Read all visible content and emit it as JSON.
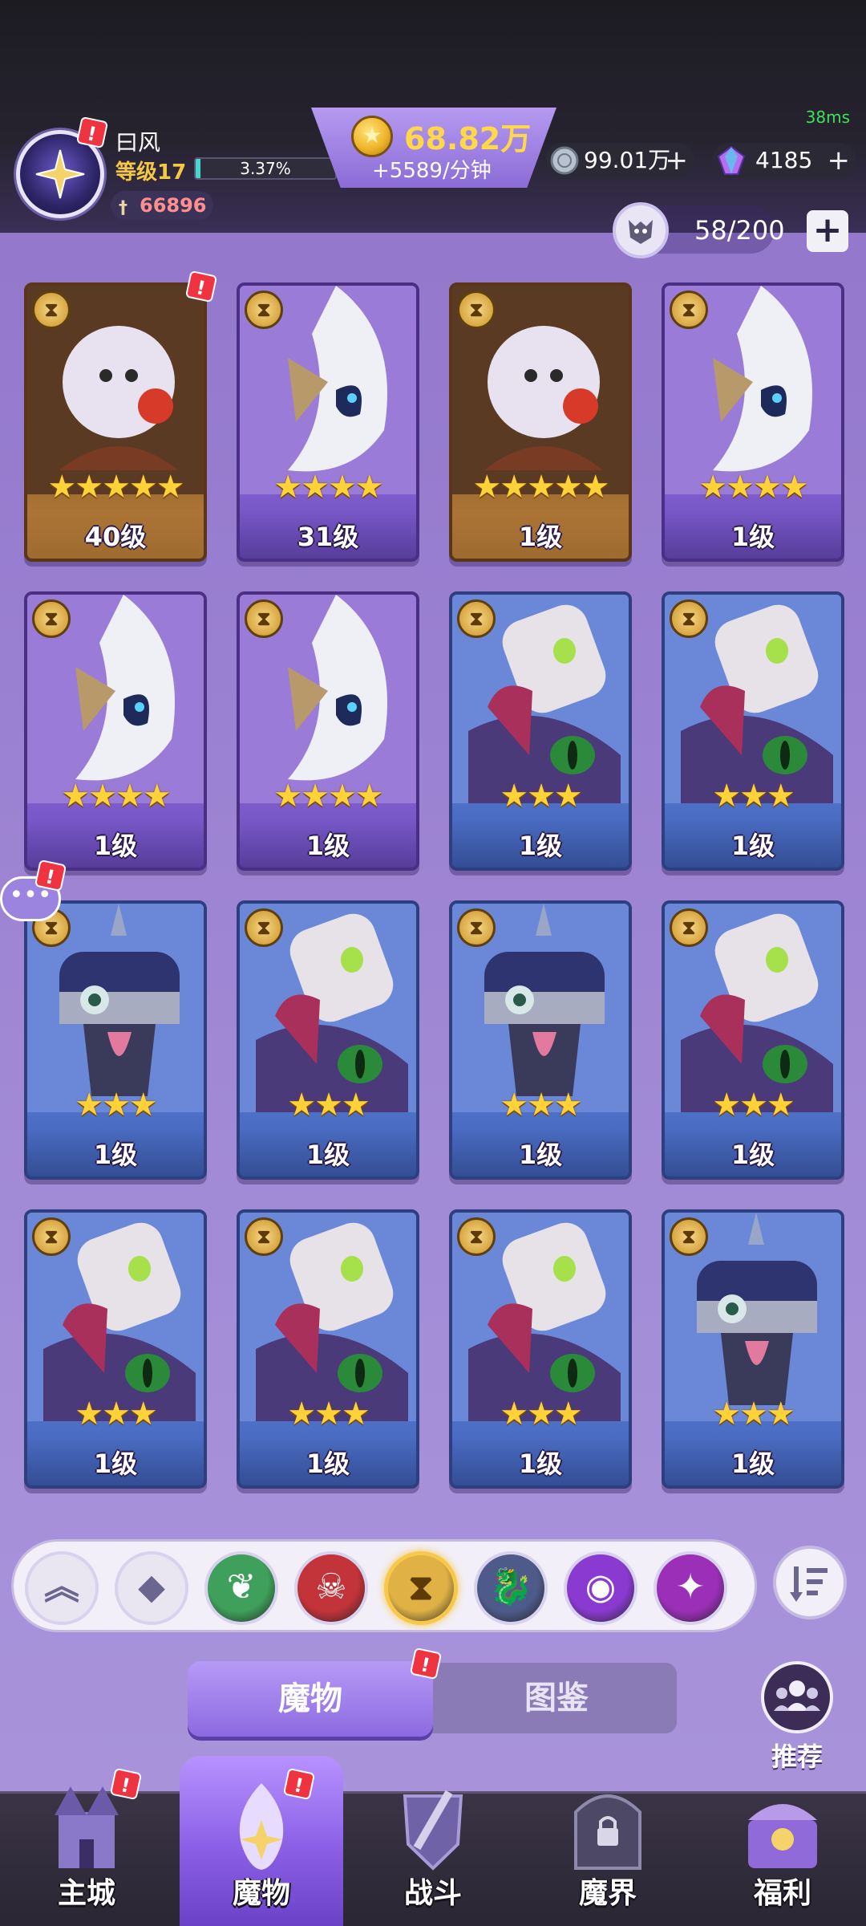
{
  "header": {
    "ping": "38ms",
    "player_name": "曰风",
    "level_label": "等级17",
    "xp_percent_text": "3.37%",
    "xp_fraction": 0.0337,
    "power": "66896",
    "gold_amount": "68.82万",
    "gold_rate": "+5589/分钟",
    "silver_amount": "99.01万",
    "gem_amount": "4185",
    "alert": "!"
  },
  "capacity": {
    "text": "58/200",
    "plus": "+"
  },
  "cards": [
    {
      "frame": "gold",
      "stars": 5,
      "level": "40级"
    },
    {
      "frame": "purple",
      "stars": 4,
      "level": "31级"
    },
    {
      "frame": "gold",
      "stars": 5,
      "level": "1级"
    },
    {
      "frame": "purple",
      "stars": 4,
      "level": "1级"
    },
    {
      "frame": "purple",
      "stars": 4,
      "level": "1级"
    },
    {
      "frame": "purple",
      "stars": 4,
      "level": "1级"
    },
    {
      "frame": "blue",
      "stars": 3,
      "level": "1级"
    },
    {
      "frame": "blue",
      "stars": 3,
      "level": "1级"
    },
    {
      "frame": "blue",
      "stars": 3,
      "level": "1级"
    },
    {
      "frame": "blue",
      "stars": 3,
      "level": "1级"
    },
    {
      "frame": "blue",
      "stars": 3,
      "level": "1级"
    },
    {
      "frame": "blue",
      "stars": 3,
      "level": "1级"
    },
    {
      "frame": "blue",
      "stars": 3,
      "level": "1级"
    },
    {
      "frame": "blue",
      "stars": 3,
      "level": "1级"
    },
    {
      "frame": "blue",
      "stars": 3,
      "level": "1级"
    },
    {
      "frame": "blue",
      "stars": 3,
      "level": "1级"
    }
  ],
  "filters": [
    {
      "icon": "chevron-up-icon",
      "color": "#e9e6f2"
    },
    {
      "icon": "diamond-grid-icon",
      "color": "#e9e6f2"
    },
    {
      "icon": "leaf-icon",
      "color": "#3ea05a"
    },
    {
      "icon": "demon-icon",
      "color": "#c2333a"
    },
    {
      "icon": "hourglass-icon",
      "color": "#e0b245"
    },
    {
      "icon": "dragon-icon",
      "color": "#4e5a8a"
    },
    {
      "icon": "eye-icon",
      "color": "#8a3ad0"
    },
    {
      "icon": "shuriken-icon",
      "color": "#9b2fb8"
    }
  ],
  "tabs": {
    "active": "魔物",
    "inactive": "图鉴"
  },
  "recommend_label": "推荐",
  "nav": [
    {
      "label": "主城",
      "icon": "castle-icon"
    },
    {
      "label": "魔物",
      "icon": "flame-icon"
    },
    {
      "label": "战斗",
      "icon": "shield-sword-icon"
    },
    {
      "label": "魔界",
      "icon": "lock-gate-icon"
    },
    {
      "label": "福利",
      "icon": "chest-icon"
    }
  ],
  "colors": {
    "accent_purple": "#8d6ae0",
    "gold_text": "#ffd84a",
    "alert_red": "#ef3340"
  }
}
